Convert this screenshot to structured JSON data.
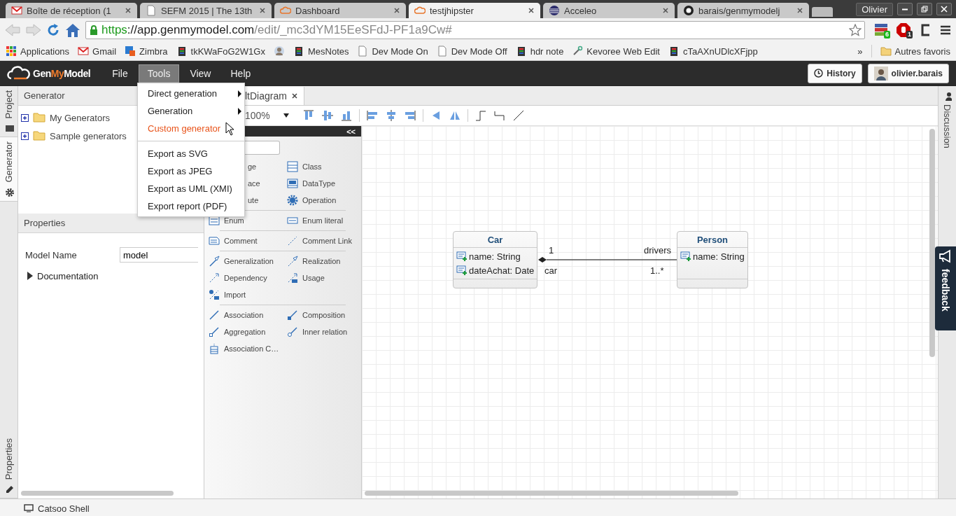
{
  "browser": {
    "tabs": [
      {
        "title": "Boîte de réception (1",
        "selected": false
      },
      {
        "title": "SEFM 2015 | The 13th",
        "selected": false
      },
      {
        "title": "Dashboard",
        "selected": false
      },
      {
        "title": "testjhipster",
        "selected": true
      },
      {
        "title": "Acceleo",
        "selected": false
      },
      {
        "title": "barais/genmymodelj",
        "selected": false
      }
    ],
    "profile": "Olivier",
    "url": {
      "scheme": "https",
      "host": "://app.genmymodel.com",
      "path": "/edit/_mc3dYM15EeSFdJ-PF1a9Cw#"
    },
    "extension_badges": [
      "6",
      "1"
    ],
    "bookmarks": [
      {
        "label": "Applications"
      },
      {
        "label": "Gmail"
      },
      {
        "label": "Zimbra"
      },
      {
        "label": "tkKWaFoG2W1Gx"
      },
      {
        "label": "MesNotes"
      },
      {
        "label": "Dev Mode On"
      },
      {
        "label": "Dev Mode Off"
      },
      {
        "label": "hdr note"
      },
      {
        "label": "Kevoree Web Edit"
      },
      {
        "label": "cTaAXnUDlcXFjpp"
      }
    ],
    "more": "»",
    "other_bookmarks": "Autres favoris"
  },
  "app": {
    "brand": {
      "prefix": "Gen",
      "accent": "My",
      "suffix": "Model"
    },
    "menu": [
      {
        "label": "File",
        "selected": false
      },
      {
        "label": "Tools",
        "selected": true
      },
      {
        "label": "View",
        "selected": false
      },
      {
        "label": "Help",
        "selected": false
      }
    ],
    "history_button": "History",
    "user": "olivier.barais",
    "dropdown": [
      {
        "kind": "item",
        "label": "Direct generation",
        "submenu": true,
        "hovered": false
      },
      {
        "kind": "item",
        "label": "Generation",
        "submenu": true,
        "hovered": false
      },
      {
        "kind": "item",
        "label": "Custom generator",
        "submenu": false,
        "hovered": true
      },
      {
        "kind": "separator"
      },
      {
        "kind": "item",
        "label": "Export as SVG",
        "submenu": false,
        "hovered": false
      },
      {
        "kind": "item",
        "label": "Export as JPEG",
        "submenu": false,
        "hovered": false
      },
      {
        "kind": "item",
        "label": "Export as UML (XMI)",
        "submenu": false,
        "hovered": false
      },
      {
        "kind": "item",
        "label": "Export report (PDF)",
        "submenu": false,
        "hovered": false
      }
    ]
  },
  "left_tabs": [
    {
      "label": "Project",
      "selected": false
    },
    {
      "label": "Generator",
      "selected": true
    }
  ],
  "left_bottom_tab": {
    "label": "Properties"
  },
  "generator_panel": {
    "title": "Generator",
    "tree": [
      {
        "label": "My Generators",
        "expanded": false
      },
      {
        "label": "Sample generators",
        "expanded": false
      }
    ]
  },
  "properties_panel": {
    "title": "Properties",
    "fields": [
      {
        "label": "Model Name",
        "value": "model"
      }
    ],
    "sections": [
      {
        "label": "Documentation",
        "expanded": false
      }
    ]
  },
  "editor": {
    "tab": "ltDiagram",
    "zoom": "100%"
  },
  "palette": {
    "collapse": "<<",
    "groups": [
      [
        {
          "label": "ge",
          "covered": true
        },
        {
          "label": "Class",
          "kind": "class",
          "covered": false
        },
        {
          "label": "ace",
          "covered": true
        },
        {
          "label": "DataType",
          "kind": "datatype",
          "covered": false
        },
        {
          "label": "ute",
          "covered": true
        },
        {
          "label": "Operation",
          "kind": "operation",
          "covered": false
        }
      ],
      [
        {
          "label": "Enum",
          "kind": "enum",
          "covered": false
        },
        {
          "label": "Enum literal",
          "kind": "literal",
          "covered": false
        }
      ],
      [
        {
          "label": "Comment",
          "kind": "comment",
          "covered": false
        },
        {
          "label": "Comment Link",
          "kind": "dashed",
          "covered": false
        }
      ],
      [
        {
          "label": "Generalization",
          "kind": "generalization",
          "covered": false
        },
        {
          "label": "Realization",
          "kind": "realization",
          "covered": false
        },
        {
          "label": "Dependency",
          "kind": "dependency",
          "covered": false
        },
        {
          "label": "Usage",
          "kind": "usage",
          "covered": false
        },
        {
          "label": "Import",
          "kind": "import",
          "covered": false
        }
      ],
      [
        {
          "label": "Association",
          "kind": "association",
          "covered": false
        },
        {
          "label": "Composition",
          "kind": "composition",
          "covered": false
        },
        {
          "label": "Aggregation",
          "kind": "aggregation",
          "covered": false
        },
        {
          "label": "Inner relation",
          "kind": "inner",
          "covered": false
        },
        {
          "label": "Association C…",
          "kind": "assocclass",
          "covered": false
        }
      ]
    ]
  },
  "diagram": {
    "classes": [
      {
        "name": "Car",
        "attributes": [
          "name: String",
          "dateAchat: Date"
        ]
      },
      {
        "name": "Person",
        "attributes": [
          "name: String"
        ]
      }
    ],
    "association": {
      "kind": "composition",
      "source_multiplicity": "1",
      "source_role": "car",
      "target_role": "drivers",
      "target_multiplicity": "1..*"
    }
  },
  "right_tabs": [
    {
      "label": "Discussion"
    }
  ],
  "feedback": "feedback",
  "bottom_bar": {
    "label": "Catsoo Shell"
  }
}
